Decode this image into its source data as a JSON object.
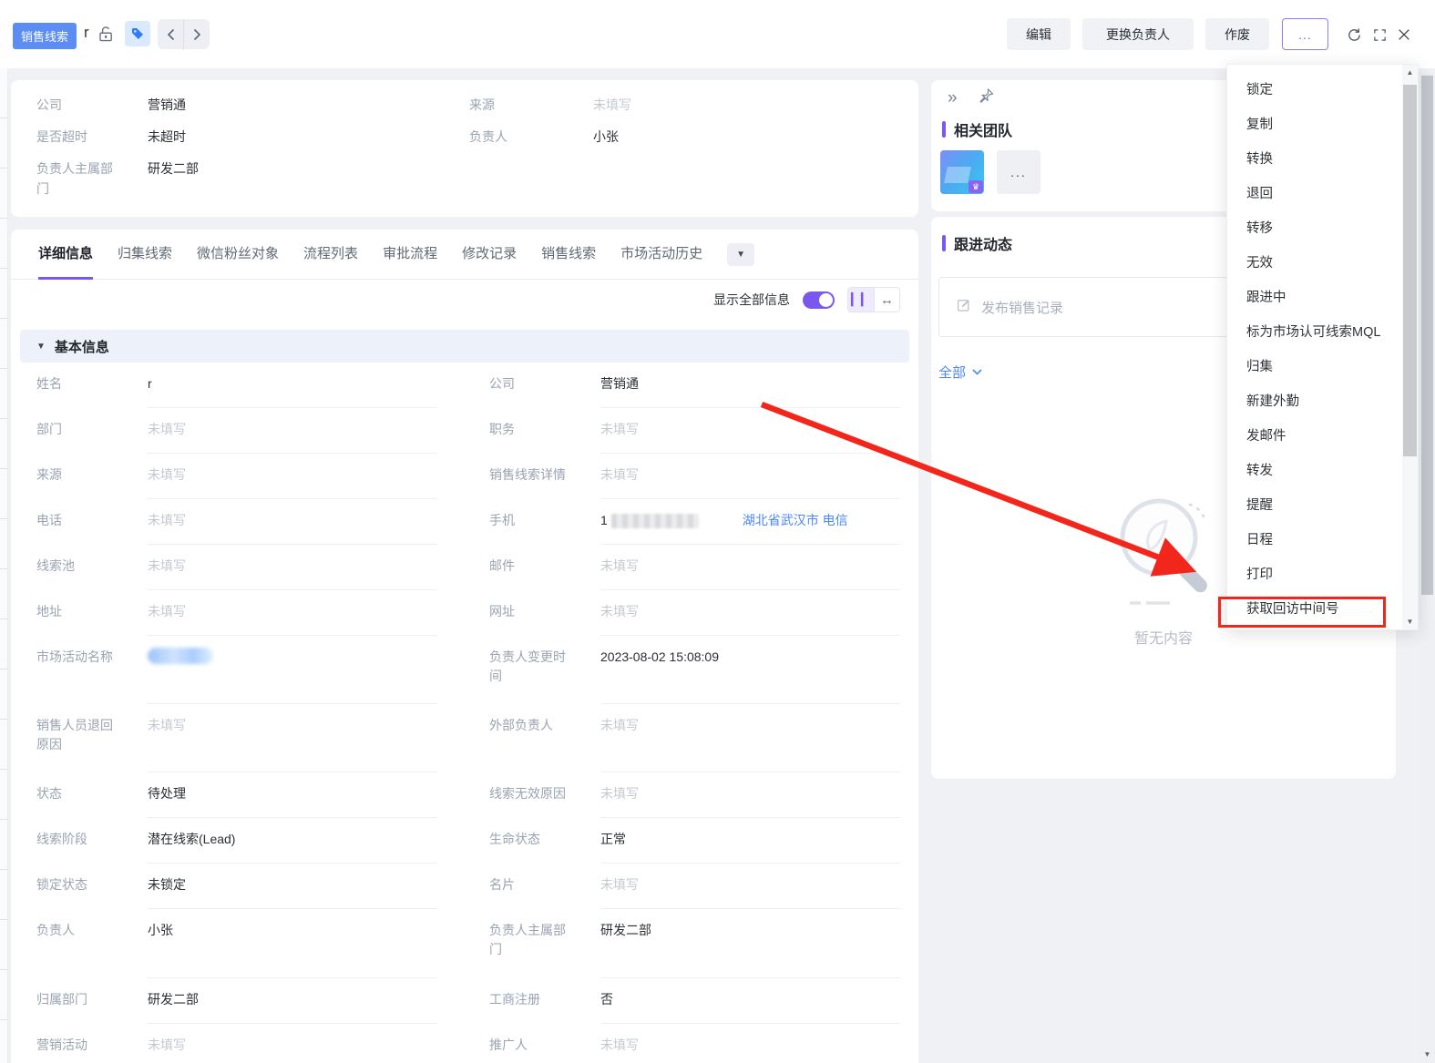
{
  "topbar": {
    "entity_badge": "销售线索",
    "record_title": "r",
    "edit_label": "编辑",
    "change_owner_label": "更换负责人",
    "invalidate_label": "作废",
    "more_label": "..."
  },
  "summary": {
    "col1": [
      {
        "label": "公司",
        "value": "营销通"
      },
      {
        "label": "是否超时",
        "value": "未超时"
      },
      {
        "label": "负责人主属部门",
        "value": "研发二部"
      }
    ],
    "col2": [
      {
        "label": "来源",
        "value": "未填写"
      },
      {
        "label": "负责人",
        "value": "小张"
      }
    ]
  },
  "tabs": {
    "items": [
      "详细信息",
      "归集线索",
      "微信粉丝对象",
      "流程列表",
      "审批流程",
      "修改记录",
      "销售线索",
      "市场活动历史"
    ],
    "active": "详细信息"
  },
  "controls": {
    "show_all_label": "显示全部信息",
    "toggle_on": true
  },
  "section": {
    "basic_info": "基本信息"
  },
  "detail": {
    "rows": [
      {
        "left": {
          "label": "姓名",
          "value": "r"
        },
        "right": {
          "label": "公司",
          "value": "营销通"
        }
      },
      {
        "left": {
          "label": "部门",
          "value": "未填写"
        },
        "right": {
          "label": "职务",
          "value": "未填写"
        }
      },
      {
        "left": {
          "label": "来源",
          "value": "未填写"
        },
        "right": {
          "label": "销售线索详情",
          "value": "未填写"
        }
      },
      {
        "left": {
          "label": "电话",
          "value": "未填写"
        },
        "right": {
          "label": "手机",
          "value": "1",
          "redacted": true,
          "extra": "湖北省武汉市 电信"
        }
      },
      {
        "left": {
          "label": "线索池",
          "value": "未填写"
        },
        "right": {
          "label": "邮件",
          "value": "未填写"
        }
      },
      {
        "left": {
          "label": "地址",
          "value": "未填写"
        },
        "right": {
          "label": "网址",
          "value": "未填写"
        }
      },
      {
        "left": {
          "label": "市场活动名称",
          "value": "",
          "redacted": true
        },
        "right": {
          "label": "负责人变更时间",
          "value": "2023-08-02 15:08:09"
        }
      },
      {
        "left": {
          "label": "销售人员退回原因",
          "value": "未填写"
        },
        "right": {
          "label": "外部负责人",
          "value": "未填写"
        }
      },
      {
        "left": {
          "label": "状态",
          "value": "待处理"
        },
        "right": {
          "label": "线索无效原因",
          "value": "未填写"
        }
      },
      {
        "left": {
          "label": "线索阶段",
          "value": "潜在线索(Lead)"
        },
        "right": {
          "label": "生命状态",
          "value": "正常"
        }
      },
      {
        "left": {
          "label": "锁定状态",
          "value": "未锁定"
        },
        "right": {
          "label": "名片",
          "value": "未填写"
        }
      },
      {
        "left": {
          "label": "负责人",
          "value": "小张"
        },
        "right": {
          "label": "负责人主属部门",
          "value": "研发二部"
        }
      },
      {
        "left": {
          "label": "归属部门",
          "value": "研发二部"
        },
        "right": {
          "label": "工商注册",
          "value": "否"
        }
      },
      {
        "left": {
          "label": "营销活动",
          "value": "未填写"
        },
        "right": {
          "label": "推广人",
          "value": "未填写"
        }
      }
    ]
  },
  "panel": {
    "team_title": "相关团队",
    "team_more": "...",
    "feed_title": "跟进动态",
    "composer_placeholder": "发布销售记录",
    "filter_all": "全部",
    "empty_text": "暂无内容"
  },
  "menu": {
    "items": [
      "锁定",
      "复制",
      "转换",
      "退回",
      "转移",
      "无效",
      "跟进中",
      "标为市场认可线索MQL",
      "归集",
      "新建外勤",
      "发邮件",
      "转发",
      "提醒",
      "日程",
      "打印",
      "获取回访中间号"
    ],
    "highlighted": "获取回访中间号"
  },
  "colors": {
    "badge_blue": "#5b8df2",
    "accent_purple": "#7a58f0",
    "link_blue": "#4a87f7",
    "annotation_red": "#f3261b"
  }
}
